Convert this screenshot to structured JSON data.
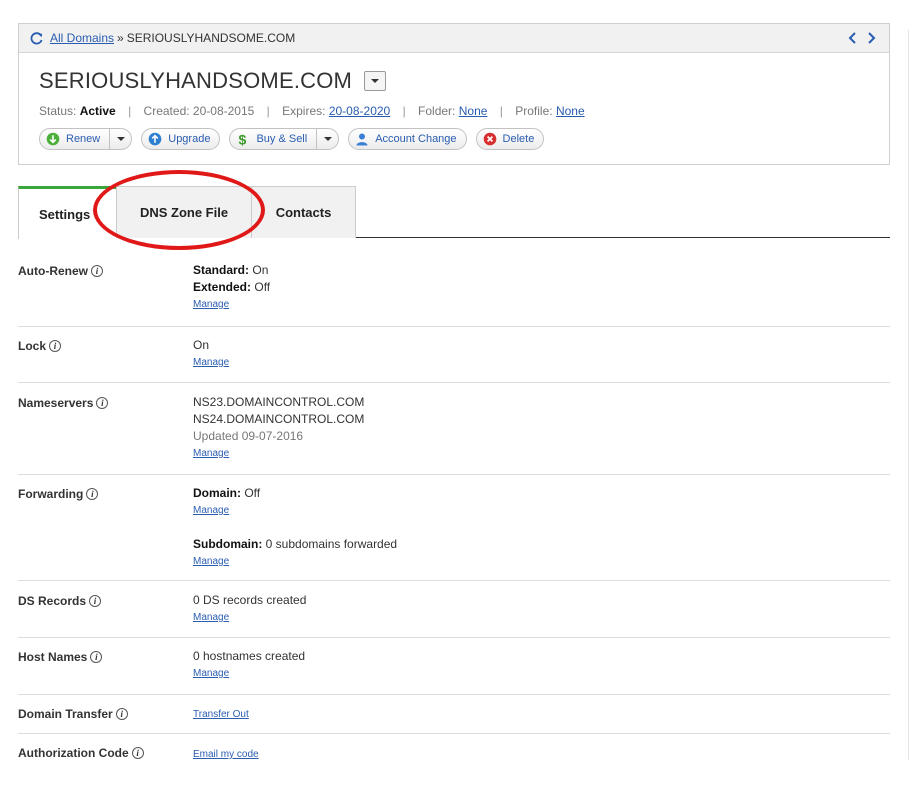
{
  "breadcrumb": {
    "root_link": "All Domains",
    "separator": "»",
    "current": "SERIOUSLYHANDSOME.COM"
  },
  "domain": {
    "name": "SERIOUSLYHANDSOME.COM"
  },
  "status_line": {
    "status_label": "Status:",
    "status_value": "Active",
    "created_label": "Created:",
    "created_value": "20-08-2015",
    "expires_label": "Expires:",
    "expires_value": "20-08-2020",
    "folder_label": "Folder:",
    "folder_value": "None",
    "profile_label": "Profile:",
    "profile_value": "None",
    "separator": "|"
  },
  "actions": {
    "renew": "Renew",
    "upgrade": "Upgrade",
    "buy_sell": "Buy & Sell",
    "account_change": "Account Change",
    "delete": "Delete"
  },
  "tabs": {
    "settings": "Settings",
    "dns": "DNS Zone File",
    "contacts": "Contacts"
  },
  "rows": {
    "auto_renew": {
      "label": "Auto-Renew",
      "standard_key": "Standard:",
      "standard_val": "On",
      "extended_key": "Extended:",
      "extended_val": "Off",
      "link": "Manage"
    },
    "lock": {
      "label": "Lock",
      "value": "On",
      "link": "Manage"
    },
    "nameservers": {
      "label": "Nameservers",
      "ns1": "NS23.DOMAINCONTROL.COM",
      "ns2": "NS24.DOMAINCONTROL.COM",
      "updated": "Updated 09-07-2016",
      "link": "Manage"
    },
    "forwarding": {
      "label": "Forwarding",
      "domain_key": "Domain:",
      "domain_val": "Off",
      "link1": "Manage",
      "sub_key": "Subdomain:",
      "sub_val": "0 subdomains forwarded",
      "link2": "Manage"
    },
    "ds_records": {
      "label": "DS Records",
      "value": "0 DS records created",
      "link": "Manage"
    },
    "host_names": {
      "label": "Host Names",
      "value": "0 hostnames created",
      "link": "Manage"
    },
    "domain_transfer": {
      "label": "Domain Transfer",
      "link": "Transfer Out"
    },
    "auth_code": {
      "label": "Authorization Code",
      "link": "Email my code"
    }
  },
  "info_glyph": "i",
  "icons": {
    "refresh": "refresh-icon",
    "prev": "chevron-left-icon",
    "next": "chevron-right-icon",
    "renew": "renew-icon",
    "upgrade": "upgrade-icon",
    "buy_sell": "dollar-icon",
    "account_change": "user-icon",
    "delete": "delete-icon",
    "info": "info-icon"
  },
  "colors": {
    "link": "#2a5db0",
    "active_tab": "#3aa63a",
    "highlight": "#e01818"
  }
}
